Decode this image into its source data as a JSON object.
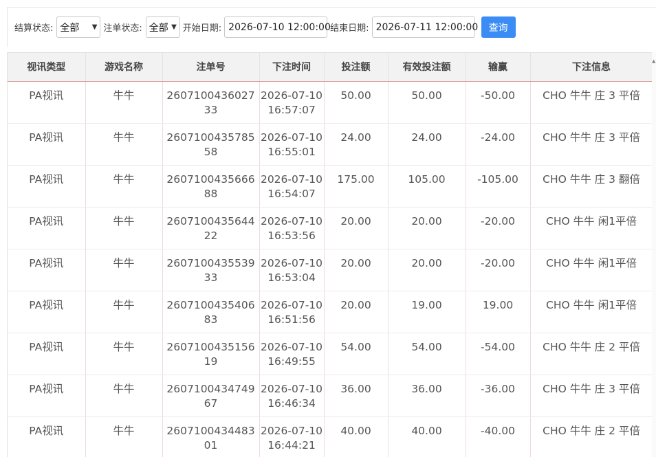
{
  "filters": {
    "settle_label": "结算状态:",
    "settle_value": "全部",
    "order_label": "注单状态:",
    "order_value": "全部",
    "start_label": "开始日期:",
    "start_value": "2026-07-10 12:00:00",
    "end_label": "结束日期:",
    "end_value": "2026-07-11 12:00:00",
    "query_label": "查询"
  },
  "table": {
    "headers": [
      "视讯类型",
      "游戏名称",
      "注单号",
      "下注时间",
      "投注额",
      "有效投注额",
      "输赢",
      "下注信息"
    ],
    "rows": [
      {
        "type": "PA视讯",
        "game": "牛牛",
        "bet_no": "260710043602733",
        "time": "2026-07-10 16:57:07",
        "amount": "50.00",
        "valid": "50.00",
        "win": "-50.00",
        "info": "CHO 牛牛 庄 3 平倍"
      },
      {
        "type": "PA视讯",
        "game": "牛牛",
        "bet_no": "260710043578558",
        "time": "2026-07-10 16:55:01",
        "amount": "24.00",
        "valid": "24.00",
        "win": "-24.00",
        "info": "CHO 牛牛 庄 3 平倍"
      },
      {
        "type": "PA视讯",
        "game": "牛牛",
        "bet_no": "260710043566688",
        "time": "2026-07-10 16:54:07",
        "amount": "175.00",
        "valid": "105.00",
        "win": "-105.00",
        "info": "CHO 牛牛 庄 3 翻倍"
      },
      {
        "type": "PA视讯",
        "game": "牛牛",
        "bet_no": "260710043564422",
        "time": "2026-07-10 16:53:56",
        "amount": "20.00",
        "valid": "20.00",
        "win": "-20.00",
        "info": "CHO 牛牛 闲1平倍"
      },
      {
        "type": "PA视讯",
        "game": "牛牛",
        "bet_no": "260710043553933",
        "time": "2026-07-10 16:53:04",
        "amount": "20.00",
        "valid": "20.00",
        "win": "-20.00",
        "info": "CHO 牛牛 闲1平倍"
      },
      {
        "type": "PA视讯",
        "game": "牛牛",
        "bet_no": "260710043540683",
        "time": "2026-07-10 16:51:56",
        "amount": "20.00",
        "valid": "19.00",
        "win": "19.00",
        "info": "CHO 牛牛 闲1平倍"
      },
      {
        "type": "PA视讯",
        "game": "牛牛",
        "bet_no": "260710043515619",
        "time": "2026-07-10 16:49:55",
        "amount": "54.00",
        "valid": "54.00",
        "win": "-54.00",
        "info": "CHO 牛牛 庄 2 平倍"
      },
      {
        "type": "PA视讯",
        "game": "牛牛",
        "bet_no": "260710043474967",
        "time": "2026-07-10 16:46:34",
        "amount": "36.00",
        "valid": "36.00",
        "win": "-36.00",
        "info": "CHO 牛牛 庄 3 平倍"
      },
      {
        "type": "PA视讯",
        "game": "牛牛",
        "bet_no": "260710043448301",
        "time": "2026-07-10 16:44:21",
        "amount": "40.00",
        "valid": "40.00",
        "win": "-40.00",
        "info": "CHO 牛牛 庄 2 平倍"
      }
    ]
  },
  "colors": {
    "accent": "#3b8cf5",
    "header_bg": "#f2f2f2"
  }
}
